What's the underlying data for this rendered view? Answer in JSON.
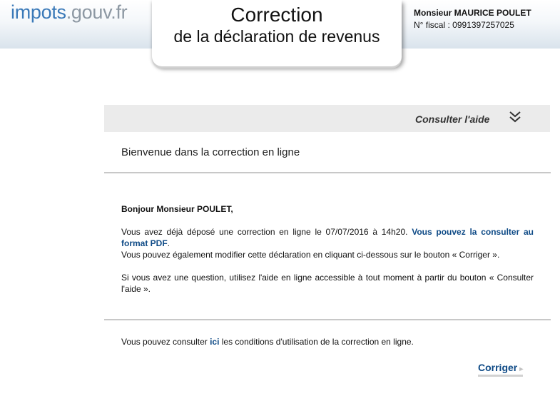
{
  "header": {
    "logo_part1": "impots",
    "logo_part2": ".gouv.fr",
    "title_line1": "Correction",
    "title_line2": "de la déclaration de revenus",
    "taxpayer_name": "Monsieur MAURICE POULET",
    "fiscal_number": "N° fiscal : 0991397257025"
  },
  "help": {
    "label": "Consulter l'aide",
    "icon": "double-chevron-down-icon"
  },
  "welcome": "Bienvenue dans la correction en ligne",
  "body": {
    "greeting": "Bonjour Monsieur POULET,",
    "para1_text": "Vous avez déjà déposé une correction en ligne le 07/07/2016 à 14h20. ",
    "para1_link": "Vous pouvez la consulter au format PDF",
    "para1_end": ".",
    "para1_line2": "Vous pouvez également modifier cette déclaration en cliquant ci-dessous sur le bouton « Corriger ».",
    "para2": "Si vous avez une question, utilisez l'aide en ligne accessible à tout moment à partir du bouton « Consulter l'aide ».",
    "conditions_before": "Vous pouvez consulter ",
    "conditions_link": "ici",
    "conditions_after": " les conditions d'utilisation de la correction en ligne."
  },
  "actions": {
    "corriger_label": "Corriger",
    "arrow_icon": "▸"
  },
  "colors": {
    "link": "#0e4a86",
    "logo_blue": "#3a79b8",
    "help_bar_bg": "#ebebeb"
  }
}
